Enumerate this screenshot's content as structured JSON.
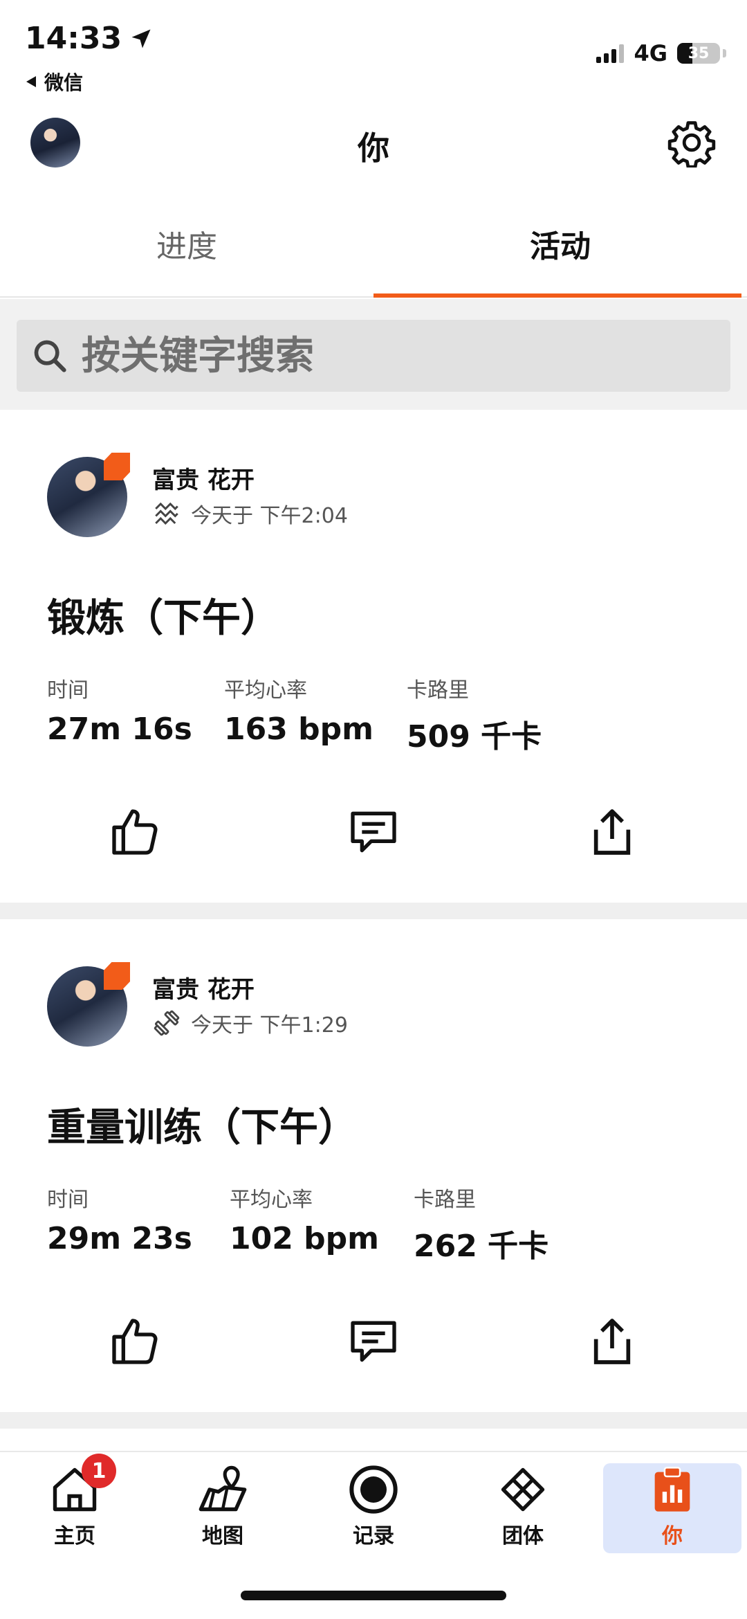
{
  "status_bar": {
    "time": "14:33",
    "back_app": "微信",
    "network": "4G",
    "battery": "35",
    "battery_level": 0.35
  },
  "header": {
    "title": "你"
  },
  "tabs": [
    {
      "label": "进度",
      "active": false
    },
    {
      "label": "活动",
      "active": true
    }
  ],
  "search": {
    "placeholder": "按关键字搜索"
  },
  "activities": [
    {
      "athlete": "富贵 花开",
      "type_icon": "workout-icon",
      "time": "今天于 下午2:04",
      "title": "锻炼（下午）",
      "stats": [
        {
          "label": "时间",
          "value": "27m 16s"
        },
        {
          "label": "平均心率",
          "value": "163 bpm"
        },
        {
          "label": "卡路里",
          "value": "509 千卡"
        }
      ]
    },
    {
      "athlete": "富贵 花开",
      "type_icon": "dumbbell-icon",
      "time": "今天于 下午1:29",
      "title": "重量训练（下午）",
      "stats": [
        {
          "label": "时间",
          "value": "29m 23s"
        },
        {
          "label": "平均心率",
          "value": "102 bpm"
        },
        {
          "label": "卡路里",
          "value": "262 千卡"
        }
      ]
    }
  ],
  "bottom_nav": [
    {
      "label": "主页",
      "icon": "home-icon",
      "badge": "1"
    },
    {
      "label": "地图",
      "icon": "map-icon"
    },
    {
      "label": "记录",
      "icon": "record-icon"
    },
    {
      "label": "团体",
      "icon": "groups-icon"
    },
    {
      "label": "你",
      "icon": "you-icon",
      "active": true
    }
  ],
  "colors": {
    "accent": "#f25c19",
    "badge": "#e02a2a",
    "active_nav_bg": "#dde6fb"
  }
}
